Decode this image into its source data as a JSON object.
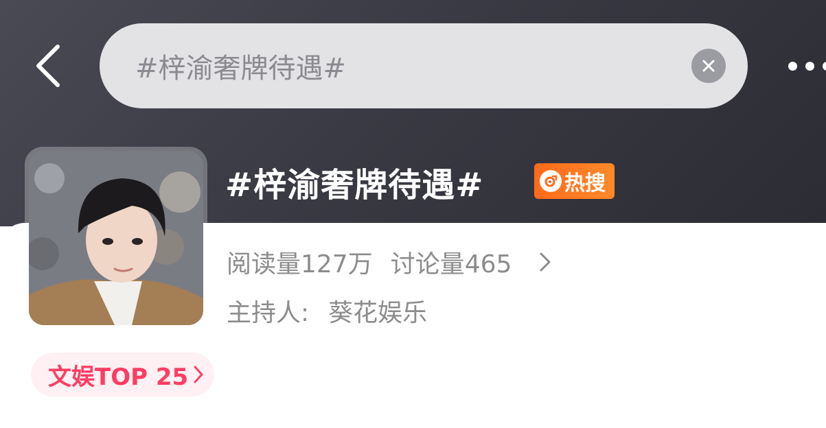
{
  "header": {
    "search_text": "#梓渝奢牌待遇#"
  },
  "topic": {
    "title": "#梓渝奢牌待遇#",
    "hot_badge": "热搜",
    "reads": "阅读量127万",
    "discussions": "讨论量465",
    "host_label": "主持人:",
    "host_name": "葵花娱乐",
    "rank_label": "文娱TOP 25"
  },
  "colors": {
    "hot_badge": "#ff7a22",
    "rank_text": "#ff3d62",
    "rank_bg": "#fff0f3",
    "header_bg": "#3a3a44"
  },
  "icons": {
    "back": "back-arrow-icon",
    "clear": "clear-icon",
    "more": "more-dots-icon",
    "hot": "hot-search-icon",
    "stats_chevron": "chevron-right-icon",
    "rank_chevron": "chevron-right-icon"
  }
}
